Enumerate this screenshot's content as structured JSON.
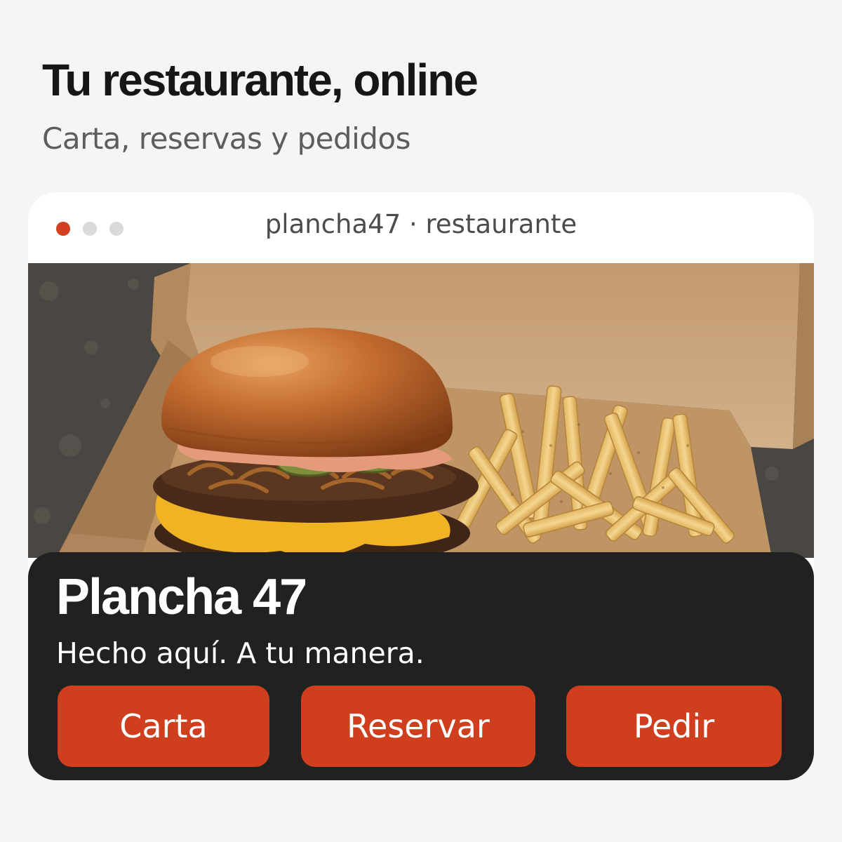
{
  "header": {
    "title": "Tu restaurante, online",
    "subtitle": "Carta, reservas y pedidos"
  },
  "browser": {
    "url": "plancha47 · restaurante",
    "window_dots": [
      "close-dot",
      "minimize-dot",
      "maximize-dot"
    ]
  },
  "hero": {
    "image": "burger-and-fries-in-kraft-box"
  },
  "restaurant": {
    "name": "Plancha 47",
    "tagline": "Hecho aquí. A tu manera."
  },
  "actions": {
    "carta_label": "Carta",
    "reservar_label": "Reservar",
    "pedir_label": "Pedir"
  },
  "colors": {
    "accent": "#cf3f1e",
    "panel": "#212121",
    "background": "#f5f5f5"
  }
}
